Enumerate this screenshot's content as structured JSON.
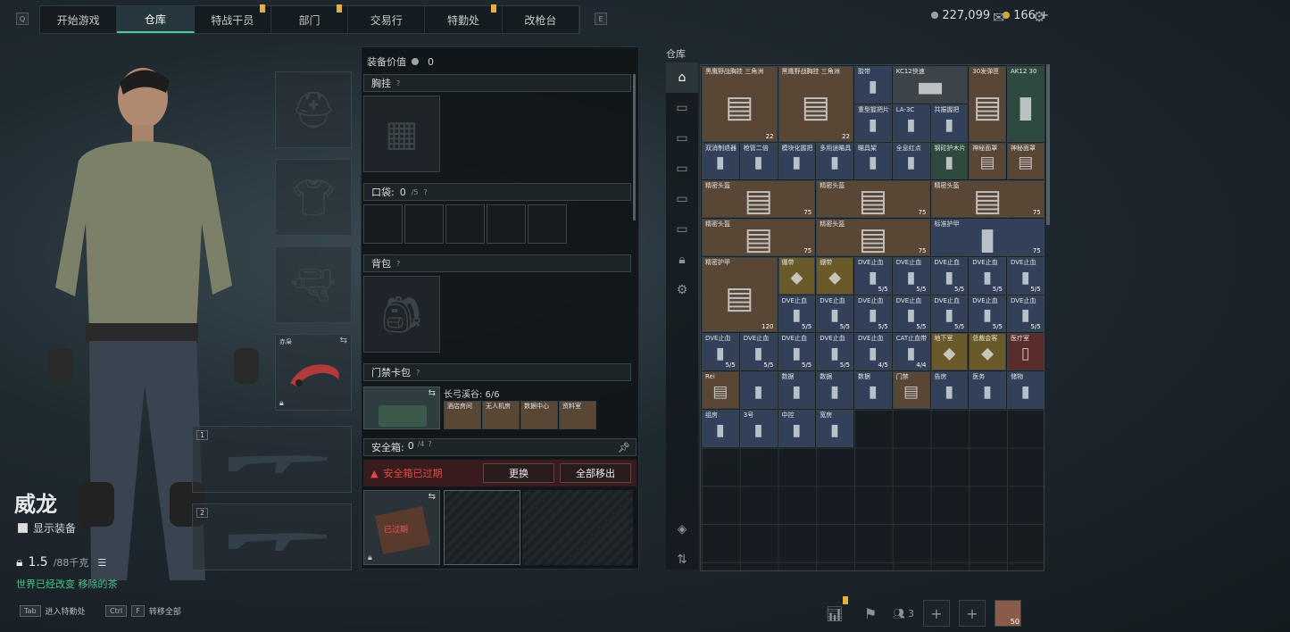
{
  "topnav": {
    "left_key": "Q",
    "right_key": "E",
    "tabs": [
      {
        "label": "开始游戏",
        "active": false,
        "badge": false
      },
      {
        "label": "仓库",
        "active": true,
        "badge": false
      },
      {
        "label": "特战干员",
        "active": false,
        "badge": true
      },
      {
        "label": "部门",
        "active": false,
        "badge": true
      },
      {
        "label": "交易行",
        "active": false,
        "badge": false
      },
      {
        "label": "特勤处",
        "active": false,
        "badge": true
      },
      {
        "label": "改枪台",
        "active": false,
        "badge": false
      }
    ]
  },
  "currency": {
    "silver": "227,099",
    "gold": "166",
    "add": "+"
  },
  "character": {
    "name": "威龙",
    "show_equipment_label": "显示装备",
    "weight": "1.5",
    "weight_cap": "/88千克",
    "subtitle": "世界已经改变 移除的茶",
    "secondary_slot_label": "赤枭",
    "weapon_slot_1": "1",
    "weapon_slot_2": "2"
  },
  "hotkeys": [
    {
      "key": "Tab",
      "label": "进入特勤处"
    },
    {
      "key": "Ctrl",
      "key2": "F",
      "label": "转移全部"
    }
  ],
  "equipment": {
    "value_label": "装备价值",
    "value": "0",
    "chest_rig": "胸挂",
    "pockets_label": "口袋:",
    "pockets_used": "0",
    "pockets_cap": "/5",
    "backpack": "背包",
    "keycard_label": "门禁卡包",
    "keycard_set": "长弓溪谷: 6/6",
    "keycards": [
      "酒店房间",
      "无人机房",
      "数据中心",
      "资料室"
    ],
    "safebox_label": "安全箱:",
    "safebox_used": "0",
    "safebox_cap": "/4",
    "safebox_expired": "安全箱已过期",
    "replace_button": "更换",
    "remove_all_button": "全部移出",
    "expired_tag": "已过期"
  },
  "warehouse": {
    "title": "仓库",
    "sidebar_icons": [
      "home-icon",
      "weapon-icon",
      "armor-icon",
      "backpack-icon",
      "ammo-icon",
      "medical-icon",
      "lock-icon",
      "gear-icon",
      "layers-icon",
      "sort-icon"
    ],
    "items": [
      {
        "name": "黑鹰野战胸挂 三角洲",
        "qty": "22",
        "color": "brown",
        "c": 0,
        "r": 0,
        "w": 2,
        "h": 2
      },
      {
        "name": "黑鹰野战胸挂 三角洲",
        "qty": "22",
        "color": "brown",
        "c": 2,
        "r": 0,
        "w": 2,
        "h": 2
      },
      {
        "name": "胶带",
        "qty": "",
        "color": "blue",
        "c": 4,
        "r": 0,
        "w": 1,
        "h": 1
      },
      {
        "name": "KC12快速",
        "qty": "",
        "color": "gray",
        "c": 5,
        "r": 0,
        "w": 2,
        "h": 1
      },
      {
        "name": "30发弹匣",
        "qty": "",
        "color": "brown",
        "c": 7,
        "r": 0,
        "w": 1,
        "h": 2
      },
      {
        "name": "AK12 30",
        "qty": "",
        "color": "green",
        "c": 8,
        "r": 0,
        "w": 1,
        "h": 2
      },
      {
        "name": "重型握把片",
        "qty": "",
        "color": "blue",
        "c": 4,
        "r": 1,
        "w": 1,
        "h": 1
      },
      {
        "name": "LA-3C",
        "qty": "",
        "color": "blue",
        "c": 5,
        "r": 1,
        "w": 1,
        "h": 1
      },
      {
        "name": "共振握把",
        "qty": "",
        "color": "blue",
        "c": 6,
        "r": 1,
        "w": 1,
        "h": 1
      },
      {
        "name": "双消制退器",
        "qty": "",
        "color": "blue",
        "c": 0,
        "r": 2,
        "w": 1,
        "h": 1
      },
      {
        "name": "枪管二倍",
        "qty": "",
        "color": "blue",
        "c": 1,
        "r": 2,
        "w": 1,
        "h": 1
      },
      {
        "name": "模块化握把",
        "qty": "",
        "color": "blue",
        "c": 2,
        "r": 2,
        "w": 1,
        "h": 1
      },
      {
        "name": "多用途瞄具",
        "qty": "",
        "color": "blue",
        "c": 3,
        "r": 2,
        "w": 1,
        "h": 1
      },
      {
        "name": "瞄具架",
        "qty": "",
        "color": "blue",
        "c": 4,
        "r": 2,
        "w": 1,
        "h": 1
      },
      {
        "name": "全息红点",
        "qty": "",
        "color": "blue",
        "c": 5,
        "r": 2,
        "w": 1,
        "h": 1
      },
      {
        "name": "钢砣护木片",
        "qty": "",
        "color": "green",
        "c": 6,
        "r": 2,
        "w": 1,
        "h": 1
      },
      {
        "name": "神秘面罩",
        "qty": "",
        "color": "brown",
        "c": 7,
        "r": 2,
        "w": 1,
        "h": 1
      },
      {
        "name": "神秘面罩",
        "qty": "",
        "color": "brown",
        "c": 8,
        "r": 2,
        "w": 1,
        "h": 1
      },
      {
        "name": "精密头盔",
        "qty": "75",
        "color": "brown",
        "c": 0,
        "r": 3,
        "w": 3,
        "h": 1
      },
      {
        "name": "精密头盔",
        "qty": "75",
        "color": "brown",
        "c": 3,
        "r": 3,
        "w": 3,
        "h": 1
      },
      {
        "name": "精密头盔",
        "qty": "75",
        "color": "brown",
        "c": 6,
        "r": 3,
        "w": 3,
        "h": 1
      },
      {
        "name": "精密头盔",
        "qty": "75",
        "color": "brown",
        "c": 0,
        "r": 4,
        "w": 3,
        "h": 1
      },
      {
        "name": "精密头盔",
        "qty": "75",
        "color": "brown",
        "c": 3,
        "r": 4,
        "w": 3,
        "h": 1
      },
      {
        "name": "标准护甲",
        "qty": "75",
        "color": "blue",
        "c": 6,
        "r": 4,
        "w": 3,
        "h": 1
      },
      {
        "name": "精密护甲",
        "qty": "120",
        "color": "brown",
        "c": 0,
        "r": 5,
        "w": 2,
        "h": 2
      },
      {
        "name": "绷带",
        "qty": "",
        "color": "gold",
        "c": 2,
        "r": 5,
        "w": 1,
        "h": 1
      },
      {
        "name": "绷带",
        "qty": "",
        "color": "gold",
        "c": 3,
        "r": 5,
        "w": 1,
        "h": 1
      },
      {
        "name": "DVE止血",
        "qty": "5/5",
        "color": "blue",
        "c": 4,
        "r": 5,
        "w": 1,
        "h": 1
      },
      {
        "name": "DVE止血",
        "qty": "5/5",
        "color": "blue",
        "c": 5,
        "r": 5,
        "w": 1,
        "h": 1
      },
      {
        "name": "DVE止血",
        "qty": "5/5",
        "color": "blue",
        "c": 6,
        "r": 5,
        "w": 1,
        "h": 1
      },
      {
        "name": "DVE止血",
        "qty": "5/5",
        "color": "blue",
        "c": 7,
        "r": 5,
        "w": 1,
        "h": 1
      },
      {
        "name": "DVE止血",
        "qty": "5/5",
        "color": "blue",
        "c": 8,
        "r": 5,
        "w": 1,
        "h": 1
      },
      {
        "name": "DVE止血",
        "qty": "5/5",
        "color": "blue",
        "c": 2,
        "r": 6,
        "w": 1,
        "h": 1
      },
      {
        "name": "DVE止血",
        "qty": "5/5",
        "color": "blue",
        "c": 3,
        "r": 6,
        "w": 1,
        "h": 1
      },
      {
        "name": "DVE止血",
        "qty": "5/5",
        "color": "blue",
        "c": 4,
        "r": 6,
        "w": 1,
        "h": 1
      },
      {
        "name": "DVE止血",
        "qty": "5/5",
        "color": "blue",
        "c": 5,
        "r": 6,
        "w": 1,
        "h": 1
      },
      {
        "name": "DVE止血",
        "qty": "5/5",
        "color": "blue",
        "c": 6,
        "r": 6,
        "w": 1,
        "h": 1
      },
      {
        "name": "DVE止血",
        "qty": "5/5",
        "color": "blue",
        "c": 7,
        "r": 6,
        "w": 1,
        "h": 1
      },
      {
        "name": "DVE止血",
        "qty": "5/5",
        "color": "blue",
        "c": 8,
        "r": 6,
        "w": 1,
        "h": 1
      },
      {
        "name": "DVE止血",
        "qty": "5/5",
        "color": "blue",
        "c": 0,
        "r": 7,
        "w": 1,
        "h": 1
      },
      {
        "name": "DVE止血",
        "qty": "5/5",
        "color": "blue",
        "c": 1,
        "r": 7,
        "w": 1,
        "h": 1
      },
      {
        "name": "DVE止血",
        "qty": "5/5",
        "color": "blue",
        "c": 2,
        "r": 7,
        "w": 1,
        "h": 1
      },
      {
        "name": "DVE止血",
        "qty": "5/5",
        "color": "blue",
        "c": 3,
        "r": 7,
        "w": 1,
        "h": 1
      },
      {
        "name": "DVE止血",
        "qty": "4/5",
        "color": "blue",
        "c": 4,
        "r": 7,
        "w": 1,
        "h": 1
      },
      {
        "name": "CAT止血带",
        "qty": "4/4",
        "color": "blue",
        "c": 5,
        "r": 7,
        "w": 1,
        "h": 1
      },
      {
        "name": "地下室",
        "qty": "",
        "color": "gold",
        "c": 6,
        "r": 7,
        "w": 1,
        "h": 1
      },
      {
        "name": "总裁会客",
        "qty": "",
        "color": "gold",
        "c": 7,
        "r": 7,
        "w": 1,
        "h": 1
      },
      {
        "name": "医疗室",
        "qty": "",
        "color": "red",
        "c": 8,
        "r": 7,
        "w": 1,
        "h": 1
      },
      {
        "name": "Rei",
        "qty": "",
        "color": "brown",
        "c": 0,
        "r": 8,
        "w": 1,
        "h": 1
      },
      {
        "name": "",
        "qty": "",
        "color": "blue",
        "c": 1,
        "r": 8,
        "w": 1,
        "h": 1
      },
      {
        "name": "数据",
        "qty": "",
        "color": "blue",
        "c": 2,
        "r": 8,
        "w": 1,
        "h": 1
      },
      {
        "name": "数据",
        "qty": "",
        "color": "blue",
        "c": 3,
        "r": 8,
        "w": 1,
        "h": 1
      },
      {
        "name": "数据",
        "qty": "",
        "color": "blue",
        "c": 4,
        "r": 8,
        "w": 1,
        "h": 1
      },
      {
        "name": "门禁",
        "qty": "",
        "color": "brown",
        "c": 5,
        "r": 8,
        "w": 1,
        "h": 1
      },
      {
        "name": "告房",
        "qty": "",
        "color": "blue",
        "c": 6,
        "r": 8,
        "w": 1,
        "h": 1
      },
      {
        "name": "医务",
        "qty": "",
        "color": "blue",
        "c": 7,
        "r": 8,
        "w": 1,
        "h": 1
      },
      {
        "name": "储物",
        "qty": "",
        "color": "blue",
        "c": 8,
        "r": 8,
        "w": 1,
        "h": 1
      },
      {
        "name": "组房",
        "qty": "",
        "color": "blue",
        "c": 0,
        "r": 9,
        "w": 1,
        "h": 1
      },
      {
        "name": "3号",
        "qty": "",
        "color": "blue",
        "c": 1,
        "r": 9,
        "w": 1,
        "h": 1
      },
      {
        "name": "中控",
        "qty": "",
        "color": "blue",
        "c": 2,
        "r": 9,
        "w": 1,
        "h": 1
      },
      {
        "name": "宽房",
        "qty": "",
        "color": "blue",
        "c": 3,
        "r": 9,
        "w": 1,
        "h": 1
      }
    ]
  },
  "bottombar": {
    "squad_count": "3",
    "level": "50"
  }
}
